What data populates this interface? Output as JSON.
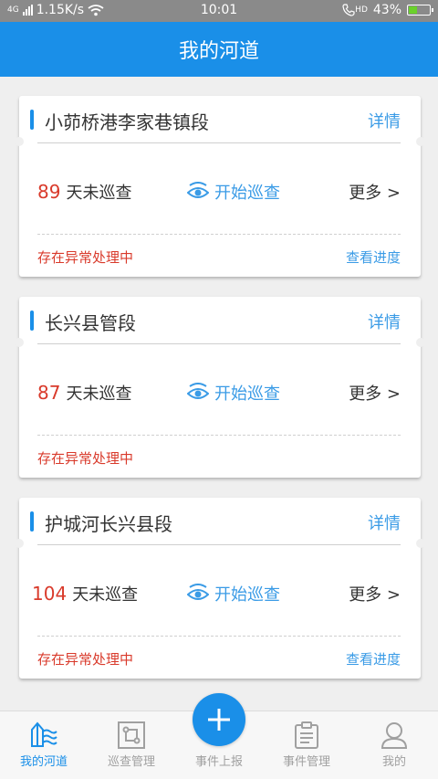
{
  "status_bar": {
    "network_type": "4G",
    "speed": "1.15K/s",
    "time": "10:01",
    "hd_label": "HD",
    "battery": "43%",
    "battery_level": 0.43
  },
  "header": {
    "title": "我的河道"
  },
  "cards": [
    {
      "name": "小茆桥港李家巷镇段",
      "detail": "详情",
      "days": "89",
      "days_label": "天未巡查",
      "start_label": "开始巡查",
      "more_label": "更多 >",
      "warning": "存在异常处理中",
      "progress_label": "查看进度"
    },
    {
      "name": "长兴县管段",
      "detail": "详情",
      "days": "87",
      "days_label": "天未巡查",
      "start_label": "开始巡查",
      "more_label": "更多 >",
      "warning": "存在异常处理中",
      "progress_label": ""
    },
    {
      "name": "护城河长兴县段",
      "detail": "详情",
      "days": "104",
      "days_label": "天未巡查",
      "start_label": "开始巡查",
      "more_label": "更多 >",
      "warning": "存在异常处理中",
      "progress_label": "查看进度"
    }
  ],
  "tabbar": {
    "items": [
      {
        "label": "我的河道",
        "icon": "river-icon",
        "active": true
      },
      {
        "label": "巡查管理",
        "icon": "patrol-icon",
        "active": false
      },
      {
        "label": "事件上报",
        "icon": "plus-icon",
        "active": false
      },
      {
        "label": "事件管理",
        "icon": "clipboard-icon",
        "active": false
      },
      {
        "label": "我的",
        "icon": "user-icon",
        "active": false
      }
    ]
  },
  "colors": {
    "primary": "#1a8fe8",
    "warning": "#d93a2b",
    "link": "#3a9be6"
  }
}
